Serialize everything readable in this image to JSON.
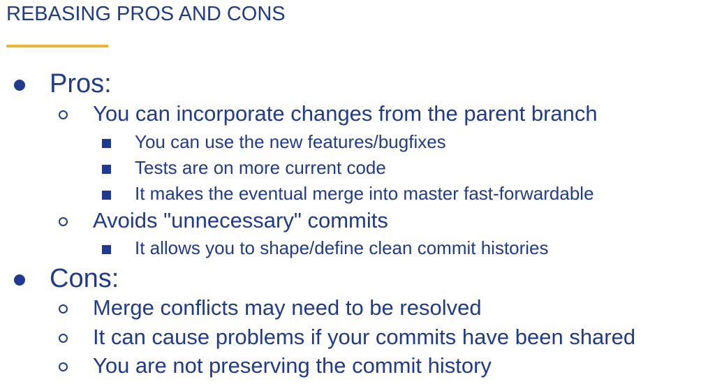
{
  "slide": {
    "title": "REBASING PROS AND CONS",
    "accent_color": "#f0b429",
    "text_color": "#1f3a93",
    "pros": {
      "label": "Pros:",
      "items": [
        {
          "text": "You can incorporate changes from the parent branch",
          "subitems": [
            "You can use the new features/bugfixes",
            "Tests are on more current code",
            "It makes the eventual merge into master fast-forwardable"
          ]
        },
        {
          "text": "Avoids \"unnecessary\" commits",
          "subitems": [
            "It allows you to shape/define clean commit histories"
          ]
        }
      ]
    },
    "cons": {
      "label": "Cons:",
      "items": [
        {
          "text": "Merge conflicts may need to be resolved"
        },
        {
          "text": "It can cause problems if your commits have been shared"
        },
        {
          "text": "You are not preserving the commit history"
        }
      ]
    }
  }
}
